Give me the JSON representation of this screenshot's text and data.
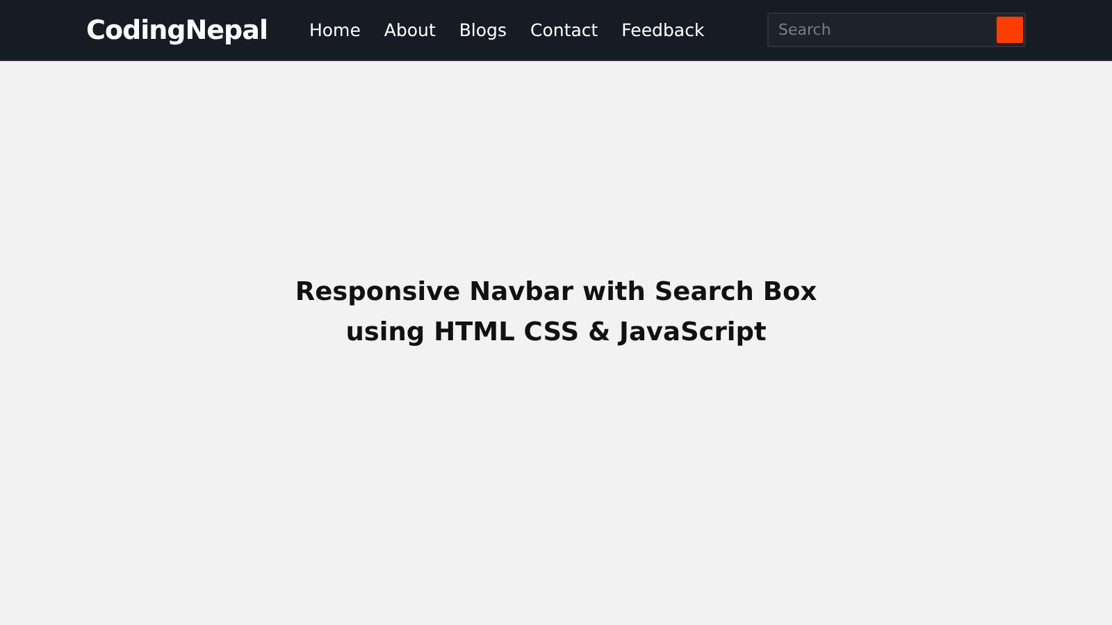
{
  "navbar": {
    "logo": "CodingNepal",
    "links": [
      "Home",
      "About",
      "Blogs",
      "Contact",
      "Feedback"
    ],
    "search": {
      "placeholder": "Search"
    }
  },
  "heading": {
    "lines": [
      "Responsive Navbar with Search Box",
      "using HTML CSS & JavaScript"
    ]
  }
}
